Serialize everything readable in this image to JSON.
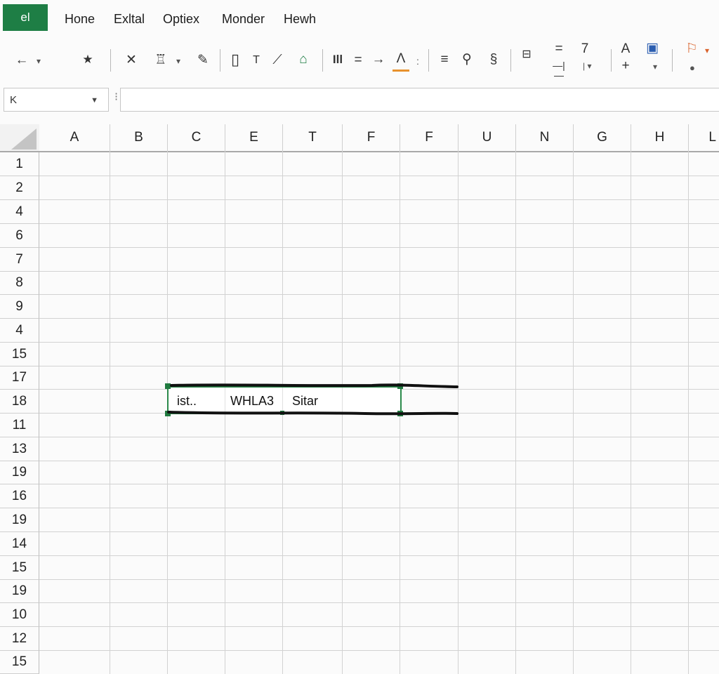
{
  "app": {
    "logo_text": "el"
  },
  "menu": {
    "items": [
      "Hone",
      "Exltal",
      "Optiex",
      "Monder",
      "Hewh"
    ]
  },
  "toolbar": {
    "undo_icon": "←",
    "star_icon": "★",
    "cut_icon": "✕",
    "brush_icon": "♖",
    "pen_icon": "✎",
    "text_box_icon": "▯",
    "text_icon": "T",
    "draw_icon": "⟋",
    "fill_icon": "⌂",
    "bars_icon": "Ill",
    "minus_icon": "=",
    "arrow_icon": "→",
    "lambda_icon": "Λ",
    "list_icon": "≡",
    "person_icon": "⚲",
    "link_icon": "§",
    "wrap_icon": "⊟",
    "num_7": "7",
    "a_letter": "A",
    "plus_icon": "+",
    "doc_icon": "▣",
    "flag_icon": "⚐"
  },
  "formula_bar": {
    "name_box": "K",
    "formula_value": ""
  },
  "grid": {
    "columns": [
      "A",
      "B",
      "C",
      "E",
      "T",
      "F",
      "F",
      "U",
      "N",
      "G",
      "H",
      "L"
    ],
    "rows": [
      "1",
      "2",
      "4",
      "6",
      "7",
      "8",
      "9",
      "4",
      "15",
      "17",
      "18",
      "11",
      "13",
      "19",
      "16",
      "19",
      "14",
      "15",
      "19",
      "10",
      "12",
      "15"
    ],
    "cells": {
      "c18": "ist..",
      "e18": "WHLA3",
      "t18": "Sitar"
    }
  },
  "colors": {
    "accent": "#1e7e45",
    "selection": "#2b8a4b",
    "highlight": "#e8912d"
  }
}
